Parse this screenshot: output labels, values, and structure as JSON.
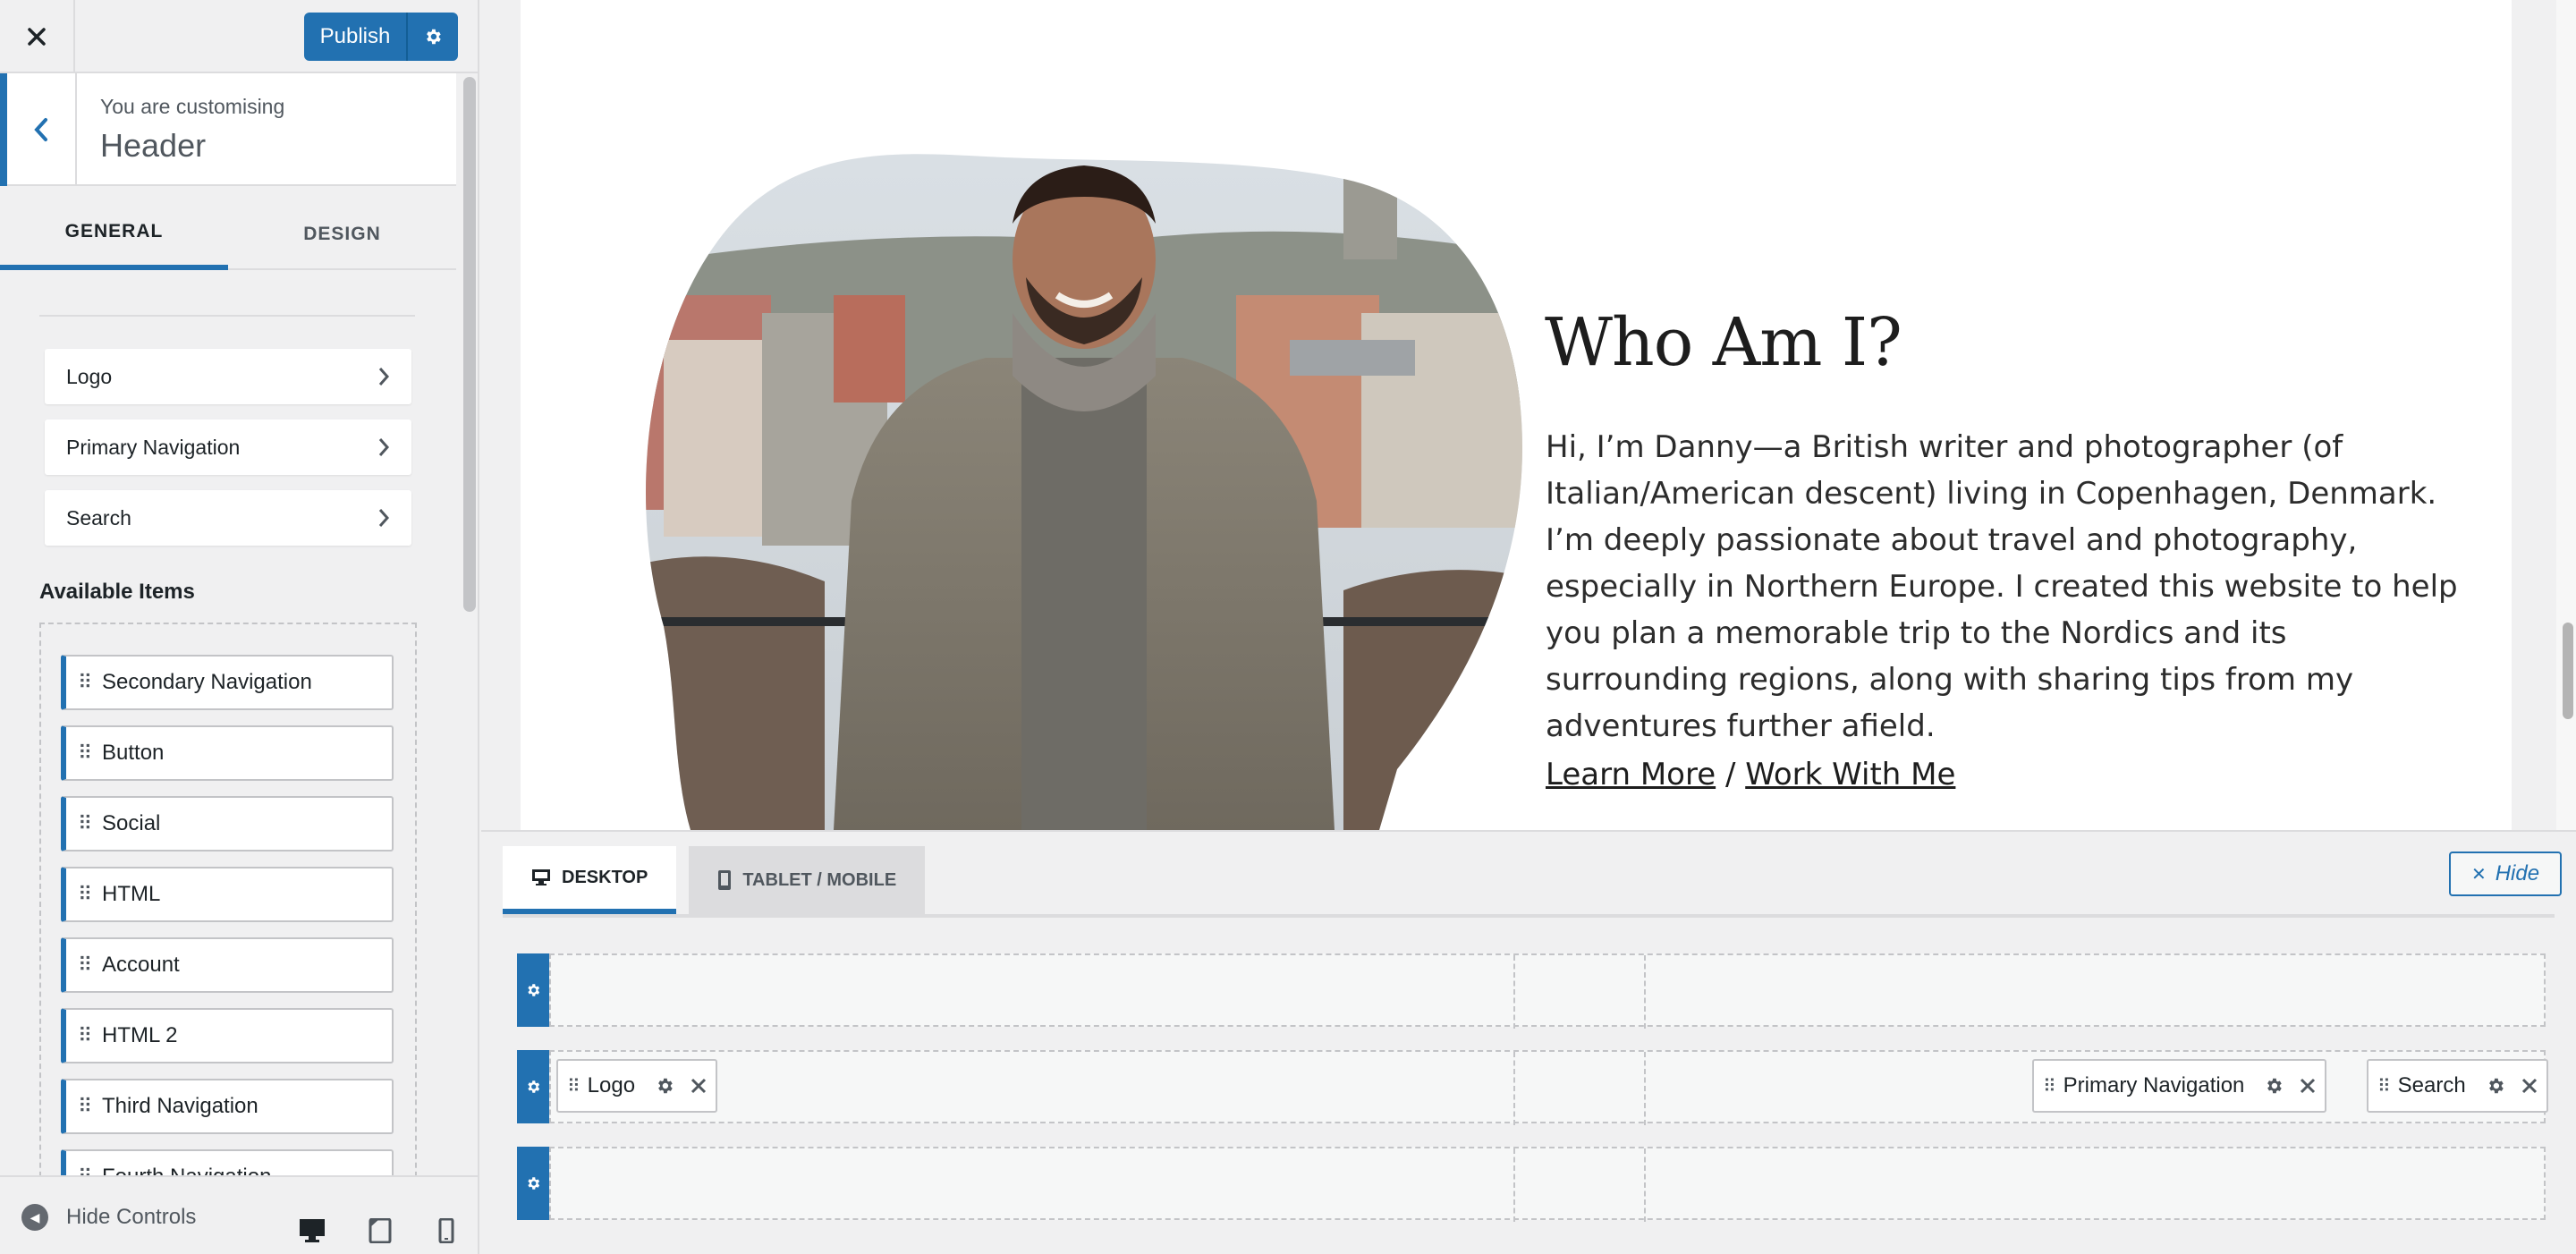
{
  "topbar": {
    "publish_label": "Publish"
  },
  "panel": {
    "customizing_label": "You are customising",
    "section_title": "Header",
    "tabs": [
      {
        "label": "GENERAL"
      },
      {
        "label": "DESIGN"
      }
    ],
    "active_items": [
      {
        "label": "Logo"
      },
      {
        "label": "Primary Navigation"
      },
      {
        "label": "Search"
      }
    ],
    "available_title": "Available Items",
    "available_items": [
      {
        "label": "Secondary Navigation"
      },
      {
        "label": "Button"
      },
      {
        "label": "Social"
      },
      {
        "label": "HTML"
      },
      {
        "label": "Account"
      },
      {
        "label": "HTML 2"
      },
      {
        "label": "Third Navigation"
      },
      {
        "label": "Fourth Navigation"
      }
    ]
  },
  "footer": {
    "hide_controls_label": "Hide Controls"
  },
  "preview": {
    "heading": "Who Am I?",
    "bio": "Hi, I’m Danny—a British writer and photographer (of Italian/American descent) living in Copenhagen, Denmark. I’m deeply passionate about travel and photography, especially in Northern Europe. I created this website to help you plan a memorable trip to the Nordics and its surrounding regions, along with sharing tips from my adventures further afield.",
    "link_learn_more": "Learn More",
    "link_separator": "/",
    "link_work_with_me": "Work With Me"
  },
  "builder": {
    "tabs": [
      {
        "label": "DESKTOP",
        "icon": "desktop-icon"
      },
      {
        "label": "TABLET / MOBILE",
        "icon": "tablet-icon"
      }
    ],
    "hide_label": "Hide",
    "row_chips": {
      "logo": "Logo",
      "primary_nav": "Primary Navigation",
      "search": "Search"
    }
  },
  "colors": {
    "accent": "#2271b1",
    "panel_bg": "#f0f0f1"
  }
}
